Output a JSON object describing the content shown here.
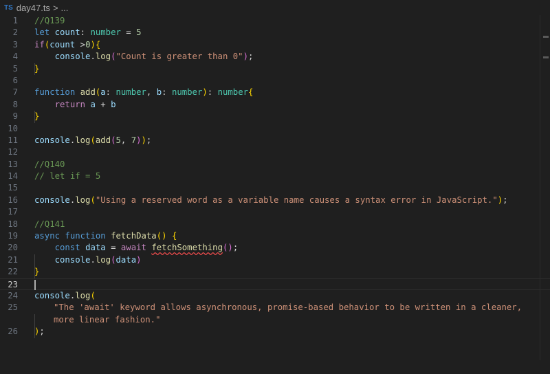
{
  "breadcrumb": {
    "lang": "TS",
    "file": "day47.ts",
    "sep": ">",
    "more": "..."
  },
  "lines": {
    "n1": "1",
    "n2": "2",
    "n3": "3",
    "n4": "4",
    "n5": "5",
    "n6": "6",
    "n7": "7",
    "n8": "8",
    "n9": "9",
    "n10": "10",
    "n11": "11",
    "n12": "12",
    "n13": "13",
    "n14": "14",
    "n15": "15",
    "n16": "16",
    "n17": "17",
    "n18": "18",
    "n19": "19",
    "n20": "20",
    "n21": "21",
    "n22": "22",
    "n23": "23",
    "n24": "24",
    "n25": "25",
    "n26": "26"
  },
  "code": {
    "l1_comment": "//Q139",
    "l2_let": "let",
    "l2_var": "count",
    "l2_colon": ": ",
    "l2_type": "number",
    "l2_eq": " = ",
    "l2_num": "5",
    "l3_if": "if",
    "l3_open": "(",
    "l3_var": "count",
    "l3_op": " >",
    "l3_num": "0",
    "l3_close": ")",
    "l3_brace": "{",
    "l4_obj": "console",
    "l4_dot": ".",
    "l4_fn": "log",
    "l4_open": "(",
    "l4_str": "\"Count is greater than 0\"",
    "l4_close": ")",
    "l4_semi": ";",
    "l5_brace": "}",
    "l7_kw": "function",
    "l7_fn": "add",
    "l7_open": "(",
    "l7_a": "a",
    "l7_c1": ": ",
    "l7_t1": "number",
    "l7_comma": ", ",
    "l7_b": "b",
    "l7_c2": ": ",
    "l7_t2": "number",
    "l7_close": ")",
    "l7_c3": ": ",
    "l7_t3": "number",
    "l7_brace": "{",
    "l8_kw": "return",
    "l8_a": "a",
    "l8_op": " + ",
    "l8_b": "b",
    "l9_brace": "}",
    "l11_obj": "console",
    "l11_dot": ".",
    "l11_fn": "log",
    "l11_open": "(",
    "l11_fn2": "add",
    "l11_open2": "(",
    "l11_n1": "5",
    "l11_comma": ", ",
    "l11_n2": "7",
    "l11_close2": ")",
    "l11_close": ")",
    "l11_semi": ";",
    "l13_comment": "//Q140",
    "l14_comment": "// let if = 5",
    "l16_obj": "console",
    "l16_dot": ".",
    "l16_fn": "log",
    "l16_open": "(",
    "l16_str": "\"Using a reserved word as a variable name causes a syntax error in JavaScript.\"",
    "l16_close": ")",
    "l16_semi": ";",
    "l18_comment": "//Q141",
    "l19_async": "async",
    "l19_kw": "function",
    "l19_fn": "fetchData",
    "l19_parens": "()",
    "l19_brace": "{",
    "l20_const": "const",
    "l20_var": "data",
    "l20_eq": " = ",
    "l20_await": "await",
    "l20_fn": "fetchSomething",
    "l20_parens": "()",
    "l20_semi": ";",
    "l21_obj": "console",
    "l21_dot": ".",
    "l21_fn": "log",
    "l21_open": "(",
    "l21_var": "data",
    "l21_close": ")",
    "l22_brace": "}",
    "l24_obj": "console",
    "l24_dot": ".",
    "l24_fn": "log",
    "l24_open": "(",
    "l25_str": "\"The 'await' keyword allows asynchronous, promise-based behavior to be written in a cleaner, more linear fashion.\"",
    "l26_close": ")",
    "l26_semi": ";"
  },
  "colors": {
    "background": "#1f1f1f",
    "comment": "#6a9955",
    "keyword": "#569cd6",
    "control": "#c586c0",
    "variable": "#9cdcfe",
    "type": "#4ec9b0",
    "function": "#dcdcaa",
    "number": "#b5cea8",
    "string": "#ce9178",
    "bracket_1": "#ffd700",
    "bracket_2": "#da70d6",
    "bracket_3": "#179fff",
    "error_squiggle": "#f14c4c"
  }
}
